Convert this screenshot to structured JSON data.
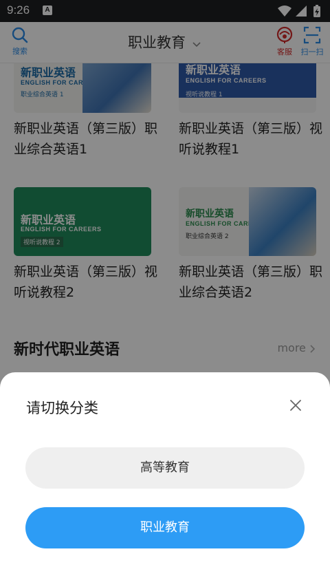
{
  "status_bar": {
    "time": "9:26",
    "notification_icon_letter": "A"
  },
  "header": {
    "search_label": "搜索",
    "title": "职业教育",
    "service_label": "客服",
    "scan_label": "扫一扫"
  },
  "books": [
    {
      "title": "新职业英语（第三版）职业综合英语1",
      "cover_main": "新职业英语",
      "cover_en": "ENGLISH FOR CAREERS",
      "cover_sub": "职业综合英语 1"
    },
    {
      "title": "新职业英语（第三版）视听说教程1",
      "cover_main": "新职业英语",
      "cover_en": "ENGLISH FOR CAREERS",
      "cover_sub": "视听说教程 1"
    },
    {
      "title": "新职业英语（第三版）视听说教程2",
      "cover_main": "新职业英语",
      "cover_en": "ENGLISH FOR CAREERS",
      "cover_sub": "视听说教程 2"
    },
    {
      "title": "新职业英语（第三版）职业综合英语2",
      "cover_main": "新职业英语",
      "cover_en": "ENGLISH FOR CAREERS",
      "cover_sub": "职业综合英语 2"
    }
  ],
  "section": {
    "title": "新时代职业英语",
    "more": "more"
  },
  "sheet": {
    "title": "请切换分类",
    "options": [
      {
        "label": "高等教育",
        "selected": false
      },
      {
        "label": "职业教育",
        "selected": true
      }
    ]
  },
  "colors": {
    "accent": "#2d9cf5",
    "service_red": "#d22a2a",
    "option_bg": "#efefef"
  }
}
